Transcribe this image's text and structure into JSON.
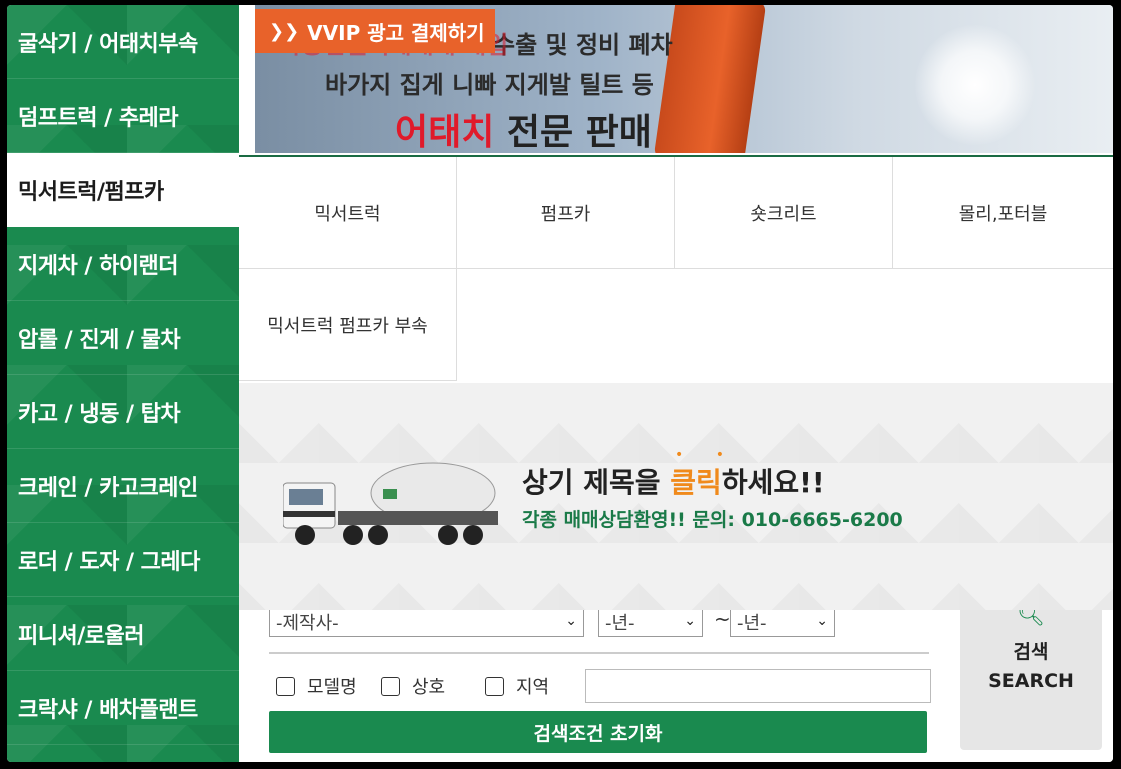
{
  "sidebar": {
    "items": [
      {
        "label": "굴삭기 / 어태치부속",
        "active": false
      },
      {
        "label": "덤프트럭 / 추레라",
        "active": false
      },
      {
        "label": "믹서트럭/펌프카",
        "active": true
      },
      {
        "label": "지게차 / 하이랜더",
        "active": false
      },
      {
        "label": "압롤 / 진게 / 물차",
        "active": false
      },
      {
        "label": "카고 / 냉동 / 탑차",
        "active": false
      },
      {
        "label": "크레인 / 카고크레인",
        "active": false
      },
      {
        "label": "로더 / 도자 / 그레다",
        "active": false
      },
      {
        "label": "피니셔/로울러",
        "active": false
      },
      {
        "label": "크락샤 / 배차플랜트",
        "active": false
      }
    ]
  },
  "banner": {
    "vvip_label": "VVIP 광고 결제하기",
    "line1": "수출 및 정비 폐차",
    "line1_partial": "각종건설기계매매 매입",
    "line2": "바가지 집게 니빠 지게발 틸트 등",
    "line3_red": "어태치",
    "line3_rest": " 전문 판매"
  },
  "submenu": {
    "items": [
      "믹서트럭",
      "펌프카",
      "숏크리트",
      "몰리,포터블",
      "믹서트럭 펌프카 부속"
    ]
  },
  "promo": {
    "title_before": "상기 제목을 ",
    "title_highlight": "클릭",
    "title_after": "하세요!!",
    "dots": "• •",
    "subtitle": "각종 매매상담환영!! 문의: 010-6665-6200"
  },
  "search": {
    "maker_select": "-제작사-",
    "year_from": "-년-",
    "year_to": "-년-",
    "tilde": "~",
    "checkboxes": [
      "모델명",
      "상호",
      "지역"
    ],
    "keyword_value": "",
    "reset_label": "검색조건 초기화",
    "search_label_ko": "검색",
    "search_label_en": "SEARCH"
  },
  "colors": {
    "brand_green": "#1a8a4f",
    "accent_orange": "#e8622a",
    "highlight_orange": "#f08a1c"
  }
}
